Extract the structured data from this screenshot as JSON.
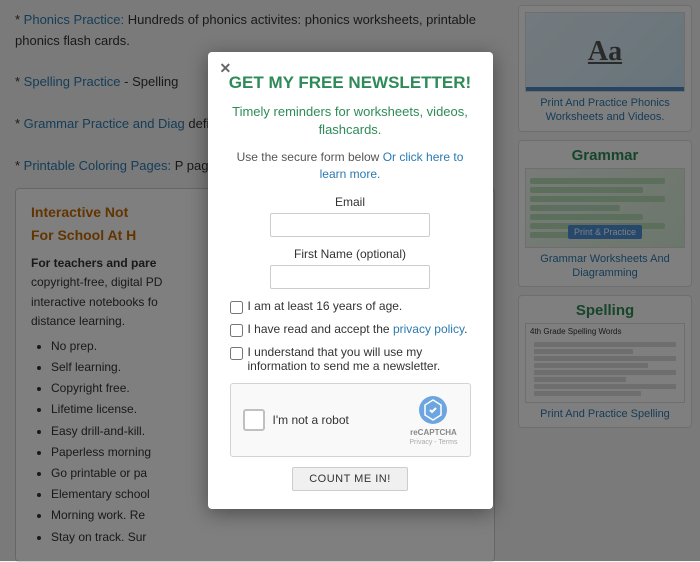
{
  "background": {
    "left": {
      "links": [
        {
          "text": "Phonics Practice:",
          "desc": " Hundreds of phonics activites: phonics worksheets, printable phonics flash cards."
        },
        {
          "text": "Spelling Practice",
          "desc": " - Spelling"
        },
        {
          "text": "Grammar Practice and Diag",
          "desc": "definitions ebooks, and PDF"
        },
        {
          "text": "Printable Coloring Pages:",
          "desc": " P pages, and country flag colo"
        }
      ],
      "interactive_box": {
        "title": "Interactive Note For School At H",
        "bold_text": "For teachers and pare",
        "desc": "copyright-free, digital PD interactive notebooks fo distance learning.",
        "list": [
          "No prep.",
          "Self learning.",
          "Copyright free.",
          "Lifetime license.",
          "Easy drill-and-kill.",
          "Paperless morning",
          "Go printable or pa",
          "Elementary school",
          "Morning work. Re",
          "Stay on track. Sur"
        ]
      }
    },
    "right": {
      "cards": [
        {
          "id": "phonics",
          "title": "",
          "ad_text": "Aa",
          "link_text": "Print And Practice Phonics Worksheets and Videos."
        },
        {
          "id": "grammar",
          "title": "Grammar",
          "link_text": "Grammar Worksheets And Diagramming"
        },
        {
          "id": "spelling",
          "title": "Spelling",
          "link_text": "Print And Practice Spelling"
        }
      ]
    }
  },
  "modal": {
    "close_symbol": "✕",
    "title": "GET MY FREE NEWSLETTER!",
    "subtitle": "Timely reminders for worksheets, videos, flashcards.",
    "secure_text": "Use the secure form below",
    "secure_link_text": "Or click here to learn more.",
    "email_label": "Email",
    "firstname_label": "First Name (optional)",
    "checkbox1_text": "I am at least 16 years of age.",
    "checkbox2_text": "I have read and accept the",
    "privacy_link": "privacy policy",
    "checkbox3_text": "I understand that you will use my information to send me a newsletter.",
    "recaptcha_text": "I'm not a robot",
    "recaptcha_brand": "reCAPTCHA",
    "recaptcha_terms": "Privacy - Terms",
    "submit_label": "COUNT ME IN!"
  }
}
